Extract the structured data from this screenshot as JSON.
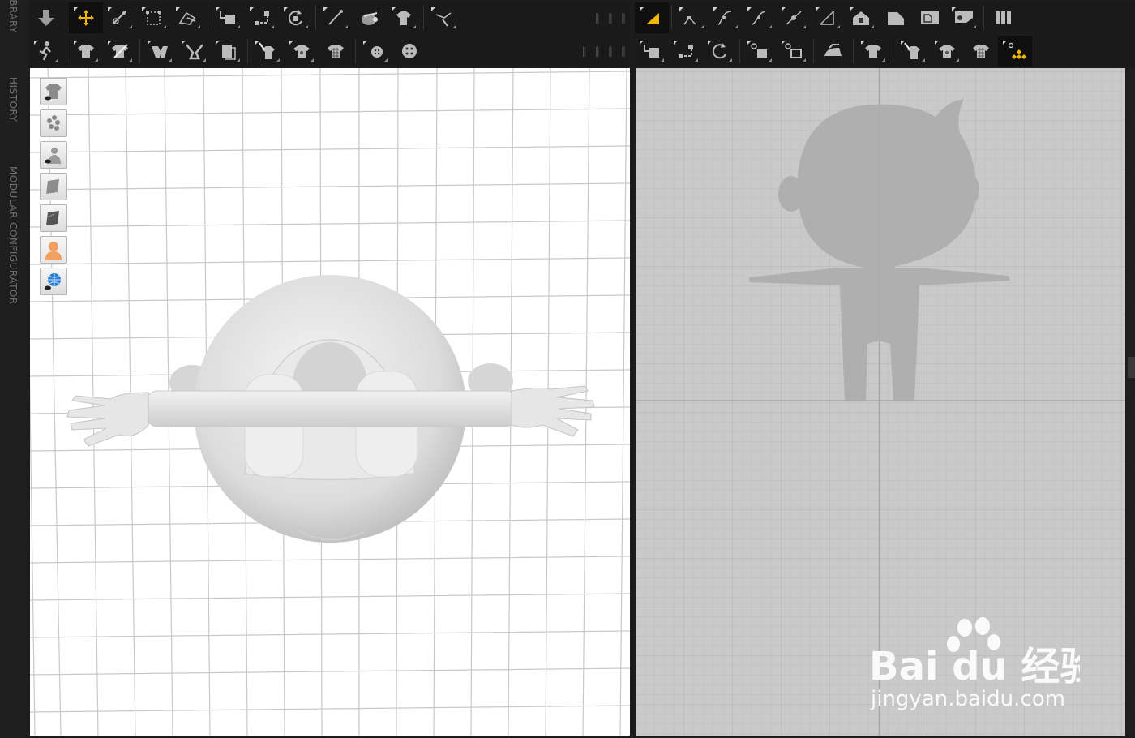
{
  "side_tabs": [
    "LIBRARY",
    "HISTORY",
    "MODULAR CONFIGURATOR"
  ],
  "toolbar_3d_row1": [
    "download-arrow-icon",
    "transform-move-icon",
    "edit-pattern-icon",
    "bounding-box-icon",
    "edit-curvature-icon",
    "fold-arrangement-icon",
    "pin-drag-icon",
    "rotate-pin-icon",
    "line-tool-icon",
    "tack-icon",
    "garment-hanger-icon",
    "polygon-select-icon"
  ],
  "toolbar_3d_row2": [
    "avatar-pose-icon",
    "shirt-arrange-icon",
    "shirt-pin-icon",
    "fold-icon",
    "cut-tool-icon",
    "strengthen-icon",
    "shirt-brush-icon",
    "shirt-texture-icon",
    "shirt-check-icon",
    "button-place-icon",
    "button-icon"
  ],
  "toolbar_2d_row1": [
    "select-pattern-icon",
    "edit-point-icon",
    "curve-point-icon",
    "bezier-curve-icon",
    "add-point-icon",
    "line-segment-icon",
    "internal-polygon-icon",
    "rectangle-icon",
    "trace-icon",
    "fill-icon",
    "seam-lines-icon"
  ],
  "toolbar_2d_row2": [
    "pin-2d-icon",
    "pin-drag-2d-icon",
    "rotate-2d-icon",
    "reshape-icon",
    "tack-2d-icon",
    "iron-icon",
    "shirt-2d-icon",
    "shirt-brush-2d-icon",
    "shirt-texture-2d-icon",
    "shirt-check-2d-icon",
    "show-points-icon"
  ],
  "view_tools": [
    "show-garment-icon",
    "show-particles-icon",
    "show-avatar-icon",
    "solid-texture-icon",
    "texture-dark-icon",
    "avatar-skin-icon",
    "environment-globe-icon"
  ],
  "watermark": {
    "brand": "Bai du 经验",
    "url": "jingyan.baidu.com"
  },
  "colors": {
    "accent": "#f2b705",
    "panel_bg": "#1a1a1a",
    "viewport_3d_bg": "#ffffff",
    "viewport_2d_bg": "#c9c9c9"
  }
}
